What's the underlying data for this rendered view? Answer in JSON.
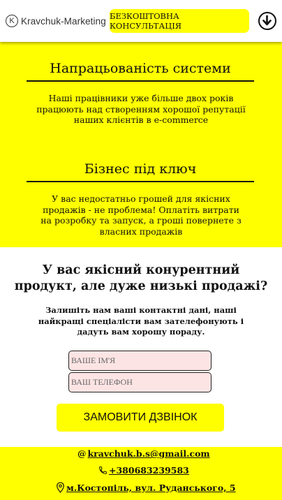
{
  "header": {
    "logo_mark": "K",
    "logo_text": "Kravchuk-Marketing",
    "consult_button": "БЕЗКОШТОВНА КОНСУЛЬТАЦІЯ"
  },
  "features": [
    {
      "title": "Напрацьованість системи",
      "text": "Наші працівники уже більше двох років працюють над створенням хорошої репутації наших клієнтів в e-commerce"
    },
    {
      "title": "Бізнес під ключ",
      "text": "У вас недостатньо грошей для якісних продажів - не проблема! Оплатіть витрати на розробку та запуск, а гроші повернете з власних продажів"
    }
  ],
  "form": {
    "title": "У вас якісний конурентний продукт, але дуже низькі продажі?",
    "subtitle": "Залишіть нам ваші контактні дані, наші найкращі спеціалісти вам зателефонують і дадуть вам хорошу пораду.",
    "name_placeholder": "ВАШЕ ІМ'Я",
    "phone_placeholder": "ВАШ ТЕЛЕФОН",
    "submit_label": "ЗАМОВИТИ ДЗВІНОК"
  },
  "footer": {
    "email_icon": "@",
    "email": "kravchuk.b.s@gmail.com",
    "phone": "+380683239583",
    "address": "м.Костопіль, вул. Руданського, 5"
  },
  "colors": {
    "accent": "#ffff00",
    "input_bg": "#fde4e4"
  }
}
